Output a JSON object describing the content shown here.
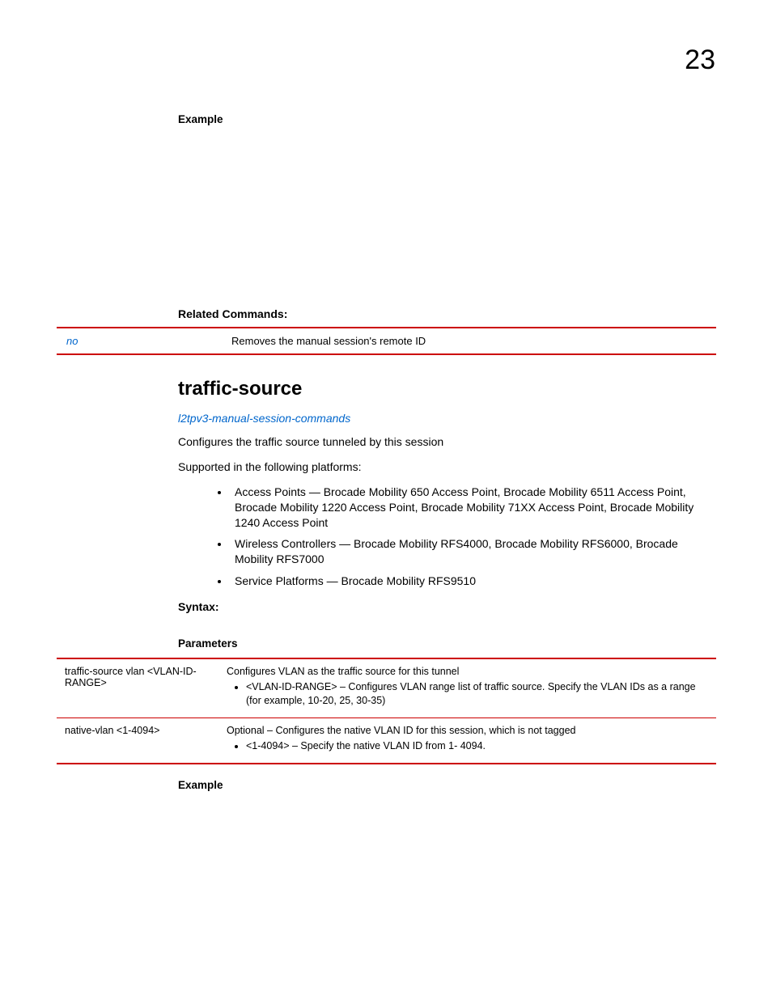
{
  "pageNumber": "23",
  "example1Heading": "Example",
  "relatedCommands": {
    "heading": "Related Commands:",
    "rows": [
      {
        "cmd": "no",
        "desc": "Removes the manual session's remote ID"
      }
    ]
  },
  "section": {
    "title": "traffic-source",
    "breadcrumb": "l2tpv3-manual-session-commands",
    "description": "Configures the traffic source tunneled by this session",
    "platformsIntro": "Supported in the following platforms:",
    "platforms": [
      "Access Points — Brocade Mobility 650 Access Point, Brocade Mobility 6511 Access Point, Brocade Mobility 1220 Access Point, Brocade Mobility 71XX Access Point, Brocade Mobility 1240 Access Point",
      "Wireless Controllers — Brocade Mobility RFS4000, Brocade Mobility RFS6000, Brocade Mobility RFS7000",
      "Service Platforms — Brocade Mobility RFS9510"
    ],
    "syntaxHeading": "Syntax:",
    "parametersHeading": "Parameters",
    "parameters": [
      {
        "name": "traffic-source vlan <VLAN-ID-RANGE>",
        "desc": "Configures VLAN as the traffic source for this tunnel",
        "bullets": [
          "<VLAN-ID-RANGE> – Configures VLAN range list of traffic source. Specify the VLAN IDs as a range (for example, 10-20, 25, 30-35)"
        ]
      },
      {
        "name": "native-vlan <1-4094>",
        "desc": "Optional – Configures the native VLAN ID for this session, which is not tagged",
        "bullets": [
          "<1-4094> – Specify the native VLAN ID from 1- 4094."
        ]
      }
    ],
    "example2Heading": "Example"
  }
}
